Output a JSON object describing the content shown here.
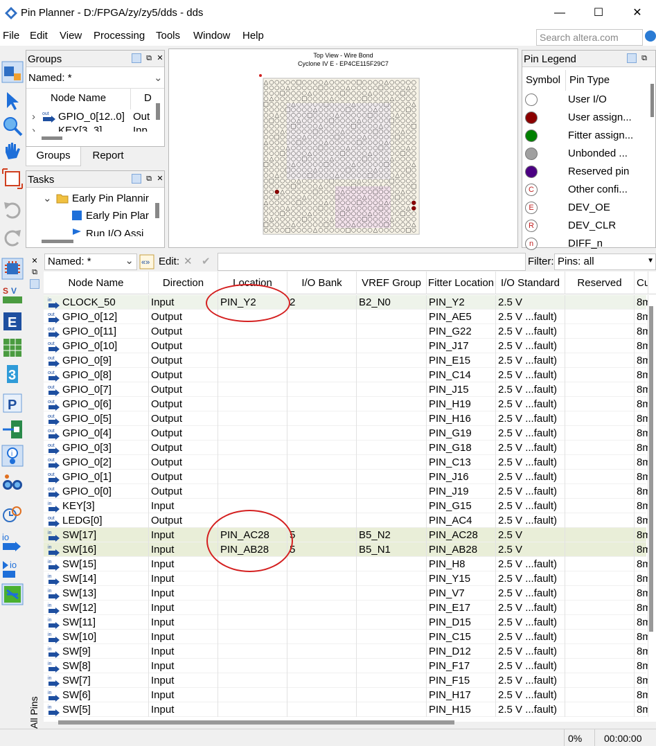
{
  "window": {
    "title": "Pin Planner - D:/FPGA/zy/zy5/dds - dds",
    "minimize": "—",
    "maximize": "☐",
    "close": "✕"
  },
  "menu": [
    "File",
    "Edit",
    "View",
    "Processing",
    "Tools",
    "Window",
    "Help"
  ],
  "search": {
    "placeholder": "Search altera.com"
  },
  "groups_panel": {
    "title": "Groups",
    "named_label": "Named: *",
    "columns": [
      "Node Name",
      "D"
    ],
    "rows": [
      {
        "name": "GPIO_0[12..0]",
        "dir": "Out"
      },
      {
        "name": "KEY[3..3]",
        "dir": "Inp"
      }
    ],
    "tabs": [
      "Groups",
      "Report"
    ]
  },
  "tasks_panel": {
    "title": "Tasks",
    "items": [
      "Early Pin Plannir",
      "Early Pin Plar",
      "Run I/O Assi"
    ]
  },
  "package_view": {
    "title_line1": "Top View - Wire Bond",
    "title_line2": "Cyclone IV E - EP4CE115F29C7"
  },
  "legend_panel": {
    "title": "Pin Legend",
    "columns": [
      "Symbol",
      "Pin Type"
    ],
    "items": [
      {
        "type": "User I/O",
        "color": "#ffffff",
        "symbol": ""
      },
      {
        "type": "User assign...",
        "color": "#8b0000",
        "symbol": ""
      },
      {
        "type": "Fitter assign...",
        "color": "#008000",
        "symbol": ""
      },
      {
        "type": "Unbonded ...",
        "color": "#a0a0a0",
        "symbol": ""
      },
      {
        "type": "Reserved pin",
        "color": "#4b0082",
        "symbol": ""
      },
      {
        "type": "Other confi...",
        "color": "#ffffff",
        "symbol": "C"
      },
      {
        "type": "DEV_OE",
        "color": "#ffffff",
        "symbol": "E"
      },
      {
        "type": "DEV_CLR",
        "color": "#ffffff",
        "symbol": "R"
      },
      {
        "type": "DIFF_n",
        "color": "#ffffff",
        "symbol": "n"
      }
    ]
  },
  "filter_bar": {
    "named_label": "Named: *",
    "edit_label": "Edit:",
    "filter_label": "Filter:",
    "filter_value": "Pins: all"
  },
  "side_tab": "All Pins",
  "table": {
    "columns": [
      "Node Name",
      "Direction",
      "Location",
      "I/O Bank",
      "VREF Group",
      "Fitter Location",
      "I/O Standard",
      "Reserved",
      "Cu"
    ],
    "rows": [
      {
        "dir_icon": "in",
        "name": "CLOCK_50",
        "direction": "Input",
        "location": "PIN_Y2",
        "bank": "2",
        "vref": "B2_N0",
        "fitter": "PIN_Y2",
        "std": "2.5 V",
        "reserved": "",
        "cu": "8m"
      },
      {
        "dir_icon": "out",
        "name": "GPIO_0[12]",
        "direction": "Output",
        "location": "",
        "bank": "",
        "vref": "",
        "fitter": "PIN_AE5",
        "std": "2.5 V ...fault)",
        "reserved": "",
        "cu": "8m"
      },
      {
        "dir_icon": "out",
        "name": "GPIO_0[11]",
        "direction": "Output",
        "location": "",
        "bank": "",
        "vref": "",
        "fitter": "PIN_G22",
        "std": "2.5 V ...fault)",
        "reserved": "",
        "cu": "8m"
      },
      {
        "dir_icon": "out",
        "name": "GPIO_0[10]",
        "direction": "Output",
        "location": "",
        "bank": "",
        "vref": "",
        "fitter": "PIN_J17",
        "std": "2.5 V ...fault)",
        "reserved": "",
        "cu": "8m"
      },
      {
        "dir_icon": "out",
        "name": "GPIO_0[9]",
        "direction": "Output",
        "location": "",
        "bank": "",
        "vref": "",
        "fitter": "PIN_E15",
        "std": "2.5 V ...fault)",
        "reserved": "",
        "cu": "8m"
      },
      {
        "dir_icon": "out",
        "name": "GPIO_0[8]",
        "direction": "Output",
        "location": "",
        "bank": "",
        "vref": "",
        "fitter": "PIN_C14",
        "std": "2.5 V ...fault)",
        "reserved": "",
        "cu": "8m"
      },
      {
        "dir_icon": "out",
        "name": "GPIO_0[7]",
        "direction": "Output",
        "location": "",
        "bank": "",
        "vref": "",
        "fitter": "PIN_J15",
        "std": "2.5 V ...fault)",
        "reserved": "",
        "cu": "8m"
      },
      {
        "dir_icon": "out",
        "name": "GPIO_0[6]",
        "direction": "Output",
        "location": "",
        "bank": "",
        "vref": "",
        "fitter": "PIN_H19",
        "std": "2.5 V ...fault)",
        "reserved": "",
        "cu": "8m"
      },
      {
        "dir_icon": "out",
        "name": "GPIO_0[5]",
        "direction": "Output",
        "location": "",
        "bank": "",
        "vref": "",
        "fitter": "PIN_H16",
        "std": "2.5 V ...fault)",
        "reserved": "",
        "cu": "8m"
      },
      {
        "dir_icon": "out",
        "name": "GPIO_0[4]",
        "direction": "Output",
        "location": "",
        "bank": "",
        "vref": "",
        "fitter": "PIN_G19",
        "std": "2.5 V ...fault)",
        "reserved": "",
        "cu": "8m"
      },
      {
        "dir_icon": "out",
        "name": "GPIO_0[3]",
        "direction": "Output",
        "location": "",
        "bank": "",
        "vref": "",
        "fitter": "PIN_G18",
        "std": "2.5 V ...fault)",
        "reserved": "",
        "cu": "8m"
      },
      {
        "dir_icon": "out",
        "name": "GPIO_0[2]",
        "direction": "Output",
        "location": "",
        "bank": "",
        "vref": "",
        "fitter": "PIN_C13",
        "std": "2.5 V ...fault)",
        "reserved": "",
        "cu": "8m"
      },
      {
        "dir_icon": "out",
        "name": "GPIO_0[1]",
        "direction": "Output",
        "location": "",
        "bank": "",
        "vref": "",
        "fitter": "PIN_J16",
        "std": "2.5 V ...fault)",
        "reserved": "",
        "cu": "8m"
      },
      {
        "dir_icon": "out",
        "name": "GPIO_0[0]",
        "direction": "Output",
        "location": "",
        "bank": "",
        "vref": "",
        "fitter": "PIN_J19",
        "std": "2.5 V ...fault)",
        "reserved": "",
        "cu": "8m"
      },
      {
        "dir_icon": "in",
        "name": "KEY[3]",
        "direction": "Input",
        "location": "",
        "bank": "",
        "vref": "",
        "fitter": "PIN_G15",
        "std": "2.5 V ...fault)",
        "reserved": "",
        "cu": "8m"
      },
      {
        "dir_icon": "out",
        "name": "LEDG[0]",
        "direction": "Output",
        "location": "",
        "bank": "",
        "vref": "",
        "fitter": "PIN_AC4",
        "std": "2.5 V ...fault)",
        "reserved": "",
        "cu": "8m"
      },
      {
        "dir_icon": "in",
        "name": "SW[17]",
        "direction": "Input",
        "location": "PIN_AC28",
        "bank": "5",
        "vref": "B5_N2",
        "fitter": "PIN_AC28",
        "std": "2.5 V",
        "reserved": "",
        "cu": "8m"
      },
      {
        "dir_icon": "in",
        "name": "SW[16]",
        "direction": "Input",
        "location": "PIN_AB28",
        "bank": "5",
        "vref": "B5_N1",
        "fitter": "PIN_AB28",
        "std": "2.5 V",
        "reserved": "",
        "cu": "8m"
      },
      {
        "dir_icon": "in",
        "name": "SW[15]",
        "direction": "Input",
        "location": "",
        "bank": "",
        "vref": "",
        "fitter": "PIN_H8",
        "std": "2.5 V ...fault)",
        "reserved": "",
        "cu": "8m"
      },
      {
        "dir_icon": "in",
        "name": "SW[14]",
        "direction": "Input",
        "location": "",
        "bank": "",
        "vref": "",
        "fitter": "PIN_Y15",
        "std": "2.5 V ...fault)",
        "reserved": "",
        "cu": "8m"
      },
      {
        "dir_icon": "in",
        "name": "SW[13]",
        "direction": "Input",
        "location": "",
        "bank": "",
        "vref": "",
        "fitter": "PIN_V7",
        "std": "2.5 V ...fault)",
        "reserved": "",
        "cu": "8m"
      },
      {
        "dir_icon": "in",
        "name": "SW[12]",
        "direction": "Input",
        "location": "",
        "bank": "",
        "vref": "",
        "fitter": "PIN_E17",
        "std": "2.5 V ...fault)",
        "reserved": "",
        "cu": "8m"
      },
      {
        "dir_icon": "in",
        "name": "SW[11]",
        "direction": "Input",
        "location": "",
        "bank": "",
        "vref": "",
        "fitter": "PIN_D15",
        "std": "2.5 V ...fault)",
        "reserved": "",
        "cu": "8m"
      },
      {
        "dir_icon": "in",
        "name": "SW[10]",
        "direction": "Input",
        "location": "",
        "bank": "",
        "vref": "",
        "fitter": "PIN_C15",
        "std": "2.5 V ...fault)",
        "reserved": "",
        "cu": "8m"
      },
      {
        "dir_icon": "in",
        "name": "SW[9]",
        "direction": "Input",
        "location": "",
        "bank": "",
        "vref": "",
        "fitter": "PIN_D12",
        "std": "2.5 V ...fault)",
        "reserved": "",
        "cu": "8m"
      },
      {
        "dir_icon": "in",
        "name": "SW[8]",
        "direction": "Input",
        "location": "",
        "bank": "",
        "vref": "",
        "fitter": "PIN_F17",
        "std": "2.5 V ...fault)",
        "reserved": "",
        "cu": "8m"
      },
      {
        "dir_icon": "in",
        "name": "SW[7]",
        "direction": "Input",
        "location": "",
        "bank": "",
        "vref": "",
        "fitter": "PIN_F15",
        "std": "2.5 V ...fault)",
        "reserved": "",
        "cu": "8m"
      },
      {
        "dir_icon": "in",
        "name": "SW[6]",
        "direction": "Input",
        "location": "",
        "bank": "",
        "vref": "",
        "fitter": "PIN_H17",
        "std": "2.5 V ...fault)",
        "reserved": "",
        "cu": "8m"
      },
      {
        "dir_icon": "in",
        "name": "SW[5]",
        "direction": "Input",
        "location": "",
        "bank": "",
        "vref": "",
        "fitter": "PIN_H15",
        "std": "2.5 V ...fault)",
        "reserved": "",
        "cu": "8m"
      }
    ]
  },
  "status": {
    "progress": "0%",
    "time": "00:00:00"
  },
  "colors": {
    "annotation_circle": "#d42020",
    "row_highlight": "#e9eed8"
  }
}
